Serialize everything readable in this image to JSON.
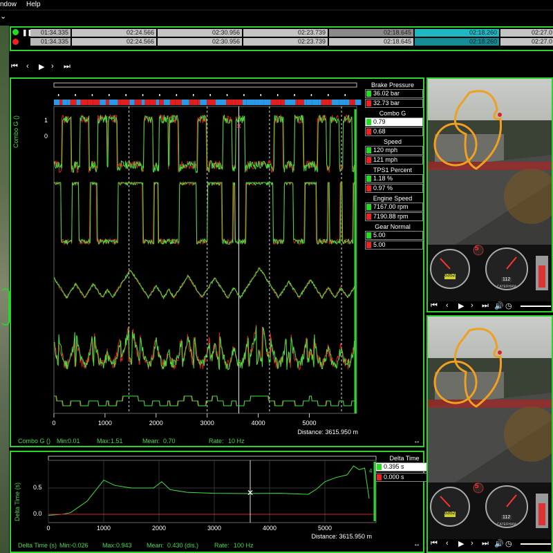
{
  "menu": {
    "window": "ndow",
    "help": "Help"
  },
  "laps": {
    "row1": [
      "01:34.335",
      "02:24.566",
      "02:30.956",
      "02:23.739",
      "02:18.645",
      "02:18.260",
      "02:27.0"
    ],
    "row2": [
      "01:34.335",
      "02:24.566",
      "02:30.956",
      "02:23.739",
      "02:18.645",
      "02:18.260",
      "02:27.0"
    ]
  },
  "plot": {
    "y_label": "Combo G ()",
    "y_ticks": [
      "1",
      "0"
    ],
    "x_ticks": [
      "0",
      "1000",
      "2000",
      "3000",
      "4000",
      "5000"
    ],
    "distance": "Distance: 3615.950 m",
    "stats": {
      "name": "Combo G ()",
      "min_label": "Min:",
      "min": "0.01",
      "max_label": "Max:",
      "max": "1.51",
      "mean_label": "Mean:",
      "mean": "0.70",
      "rate_label": "Rate:",
      "rate": "10 Hz"
    }
  },
  "readouts": [
    {
      "title": "Brake Pressure",
      "v1": "36.02 bar",
      "v2": "32.73 bar"
    },
    {
      "title": "Combo G",
      "v1": "0.79",
      "v2": "0.68"
    },
    {
      "title": "Speed",
      "v1": "120 mph",
      "v2": "121 mph"
    },
    {
      "title": "TPS1 Percent Position",
      "v1": "1.18 %",
      "v2": "0.97 %"
    },
    {
      "title": "Engine Speed",
      "v1": "7167.00 rpm",
      "v2": "7190.88 rpm"
    },
    {
      "title": "Gear Normal",
      "v1": "5.00",
      "v2": "5.00"
    }
  ],
  "delta": {
    "y_label": "Delta Time (s)",
    "y_ticks": [
      "0.5",
      "0.0"
    ],
    "x_ticks": [
      "0",
      "1000",
      "2000",
      "3000",
      "4000",
      "5000"
    ],
    "distance": "Distance: 3615.950 m",
    "readout_title": "Delta Time",
    "v1": "0.395 s",
    "v2": "0.000 s",
    "marker": "4",
    "stats": {
      "name": "Delta Time (s)",
      "min_label": "Min:",
      "min": "-0.026",
      "max_label": "Max:",
      "max": "0.943",
      "mean_label": "Mean:",
      "mean": "0.430 (dis.)",
      "rate_label": "Rate:",
      "rate": "100 Hz"
    }
  },
  "video": {
    "gear": "5",
    "brand": "CATERHAM",
    "speed_top": "112",
    "speed_bottom": "112",
    "rpm_top": "6352",
    "rpm_bottom": "6352"
  },
  "colors": {
    "accent": "#2ad42a",
    "lap1": "#22dd22",
    "lap2": "#ee2222",
    "blue": "#2a9ae8",
    "red": "#e02020",
    "cyan": "#1fb8c2"
  }
}
